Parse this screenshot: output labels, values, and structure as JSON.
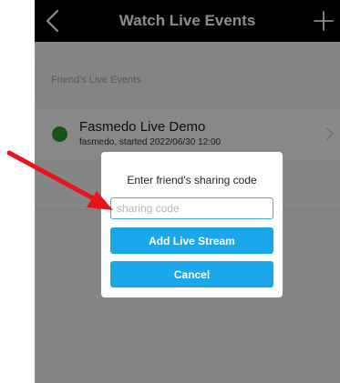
{
  "navbar": {
    "title": "Watch Live Events",
    "back_icon": "chevron-left-icon",
    "add_icon": "plus-icon"
  },
  "section": {
    "label": "Friend's Live Events"
  },
  "events": [
    {
      "title": "Fasmedo Live Demo",
      "subtitle": "fasmedo, started 2022/06/30 12:00",
      "status_color": "#2a9a2a"
    }
  ],
  "dialog": {
    "title": "Enter friend's sharing code",
    "input_value": "",
    "input_placeholder": "sharing code",
    "add_label": "Add Live Stream",
    "cancel_label": "Cancel"
  },
  "colors": {
    "accent": "#1aa7ec",
    "navbar": "#000000",
    "annotation_arrow": "#e8141b"
  }
}
